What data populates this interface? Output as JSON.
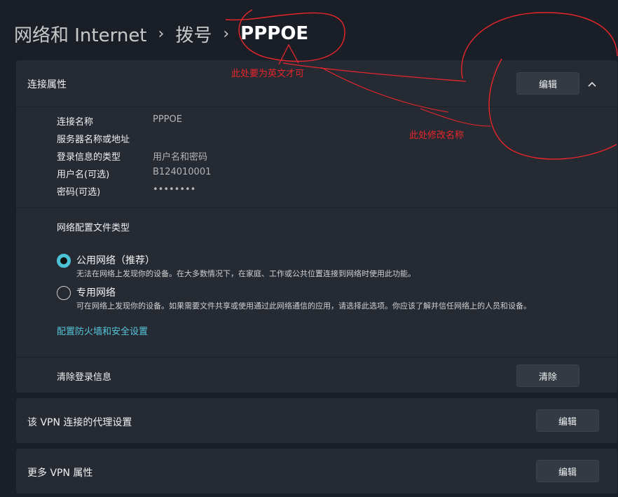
{
  "breadcrumb": {
    "item1": "网络和 Internet",
    "item2": "拨号",
    "current": "PPPOE",
    "separator": "›"
  },
  "connection": {
    "header_label": "连接属性",
    "edit_label": "编辑",
    "collapse_icon": "chevron-up-icon",
    "properties": [
      {
        "key": "连接名称",
        "value": "PPPOE"
      },
      {
        "key": "服务器名称或地址",
        "value": ""
      },
      {
        "key": "登录信息的类型",
        "value": "用户名和密码"
      },
      {
        "key": "用户名(可选)",
        "value": "B124010001"
      },
      {
        "key": "密码(可选)",
        "value": "••••••••"
      }
    ],
    "profile": {
      "title": "网络配置文件类型",
      "options": [
        {
          "title": "公用网络（推荐）",
          "desc": "无法在网络上发现你的设备。在大多数情况下，在家庭、工作或公共位置连接到网络时使用此功能。",
          "selected": true
        },
        {
          "title": "专用网络",
          "desc": "可在网络上发现你的设备。如果需要文件共享或使用通过此网络通信的应用，请选择此选项。你应该了解并信任网络上的人员和设备。",
          "selected": false
        }
      ],
      "firewall_link": "配置防火墙和安全设置"
    },
    "clear": {
      "label": "清除登录信息",
      "button": "清除"
    }
  },
  "proxy": {
    "label": "该 VPN 连接的代理设置",
    "button": "编辑"
  },
  "more": {
    "label": "更多 VPN 属性",
    "button": "编辑"
  },
  "annotations": {
    "note1": "此处要为英文才可",
    "note2": "此处修改名称",
    "color": "#e8262b"
  },
  "colors": {
    "accent": "#4cc2d6",
    "background": "#1a1f27",
    "card": "#252a33"
  }
}
